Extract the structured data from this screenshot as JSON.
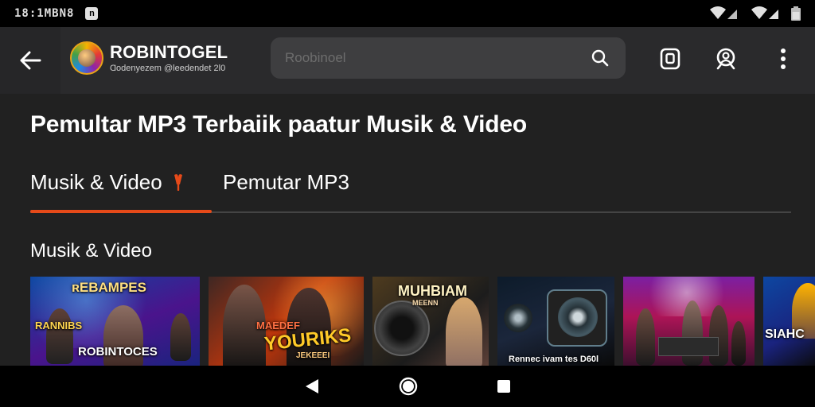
{
  "status_bar": {
    "time": "18:1MBN8",
    "notification_icon": "n-badge-icon",
    "icons": [
      "wifi-icon",
      "signal-icon",
      "battery-icon"
    ]
  },
  "app_bar": {
    "brand_title": "ROBINTOGEL",
    "brand_subtitle": "Ɑodenyezem @leedendet 2l0",
    "search": {
      "placeholder": "Roobinoel"
    },
    "icons": [
      "back-arrow-icon",
      "search-icon",
      "screenshot-icon",
      "user-search-icon",
      "more-vert-icon"
    ]
  },
  "main": {
    "page_title": "Pemultar MP3 Terbaiik paatur Musik & Video",
    "tabs": [
      {
        "label": "Musik & Video",
        "active": true
      },
      {
        "label": "Pemutar MP3",
        "active": false
      }
    ],
    "section_title": "Musik & Video",
    "cards": [
      {
        "top_label": "ʀEBAMPES",
        "mid_label": "RANNIBS",
        "bottom_label": "ROBINTOCES"
      },
      {
        "top_label": "MAEDEF",
        "mid_label": "YOURIKS",
        "bottom_label": "JEKEEEI"
      },
      {
        "top_label": "MUHBIAM",
        "mid_label": "MEENN",
        "bottom_label": ""
      },
      {
        "top_label": "",
        "mid_label": "",
        "bottom_label": "Rennec ivam tes D60l"
      },
      {
        "top_label": "",
        "mid_label": "",
        "bottom_label": ""
      },
      {
        "top_label": "",
        "mid_label": "",
        "bottom_label": "SIAHC"
      }
    ]
  },
  "nav_bar": {
    "icons": [
      "back-triangle-icon",
      "home-circle-icon",
      "recents-square-icon"
    ]
  },
  "colors": {
    "accent": "#e64a19",
    "background": "#212121",
    "app_bar": "#2a2a2c",
    "search_bg": "#3e3e40"
  }
}
